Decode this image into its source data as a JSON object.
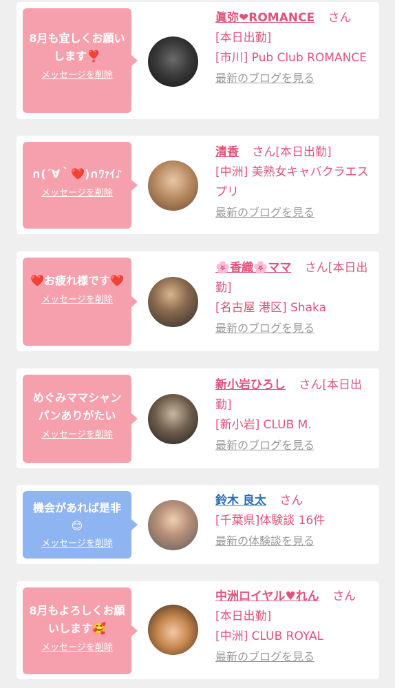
{
  "cards": [
    {
      "message": "8月も宜しくお願いします❣️",
      "delete_label": "メッセージを削除",
      "name": "眞弥❤ROMANCE",
      "honorific": "さん",
      "status": "[本日出勤]",
      "shop": "[市川] Pub Club ROMANCE",
      "link": "最新のブログを見る"
    },
    {
      "message": "∩(´∀｀❤️)∩ﾜｧｲ♪",
      "delete_label": "メッセージを削除",
      "name": "清香",
      "honorific": "さん",
      "status": "[本日出勤]",
      "shop": "[中洲] 美熟女キャバクラエスプリ",
      "link": "最新のブログを見る"
    },
    {
      "message": "❤️お疲れ様です❤️",
      "delete_label": "メッセージを削除",
      "name": "🌸香織🌸ママ",
      "honorific": "さん",
      "status": "[本日出勤]",
      "shop": "[名古屋 港区] Shaka",
      "link": "最新のブログを見る"
    },
    {
      "message": "めぐみママシャンパンありがたい",
      "delete_label": "メッセージを削除",
      "name": "新小岩ひろし",
      "honorific": "さん",
      "status": "[本日出勤]",
      "shop": "[新小岩] CLUB M.",
      "link": "最新のブログを見る"
    },
    {
      "message": "機会があれば是非😊",
      "delete_label": "メッセージを削除",
      "name": "鈴木 良太",
      "honorific": "さん",
      "status": "",
      "shop": "[千葉県]体験談 16件",
      "link": "最新の体験談を見る"
    },
    {
      "message": "8月もよろしくお願いします🥰",
      "delete_label": "メッセージを削除",
      "name": "中洲ロイヤル♥れん",
      "honorific": "さん",
      "status": "[本日出勤]",
      "shop": "[中洲] CLUB ROYAL",
      "link": "最新のブログを見る"
    }
  ],
  "colors": {
    "bubble_pink": "#f7a0ad",
    "bubble_blue": "#8fb4f2",
    "name_pink": "#e0527a",
    "name_blue": "#2c6fb8",
    "link_gray": "#999999"
  },
  "icons": [
    "avatar-photo",
    "speech-bubble-pointer"
  ]
}
